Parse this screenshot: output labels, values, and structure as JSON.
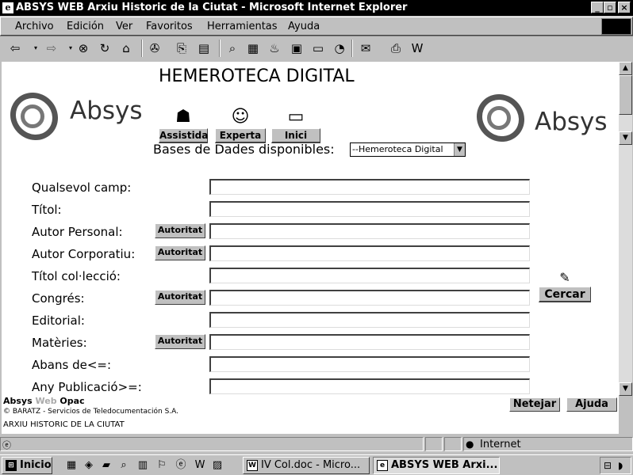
{
  "window": {
    "title": "ABSYS WEB Arxiu Historic de la Ciutat - Microsoft Internet Explorer"
  },
  "menu": [
    "Archivo",
    "Edición",
    "Ver",
    "Favoritos",
    "Herramientas",
    "Ayuda"
  ],
  "page": {
    "header": "HEMEROTECA DIGITAL",
    "logo_text": "Absys",
    "modes": [
      "Assistida",
      "Experta",
      "Inici"
    ],
    "databases_label": "Bases de Dades disponibles:",
    "database_selected": "--Hemeroteca Digital",
    "fields": [
      {
        "label": "Qualsevol camp:",
        "value": ""
      },
      {
        "label": "Títol:",
        "value": ""
      },
      {
        "label": "Autor Personal:",
        "value": ""
      },
      {
        "label": "Autor Corporatiu:",
        "value": ""
      },
      {
        "label": "Títol col·lecció:",
        "value": ""
      },
      {
        "label": "Congrés:",
        "value": ""
      },
      {
        "label": "Editorial:",
        "value": ""
      },
      {
        "label": "Matèries:",
        "value": ""
      },
      {
        "label": "Abans de<=:",
        "value": ""
      },
      {
        "label": "Any Publicació>=:",
        "value": ""
      }
    ],
    "authority_label": "Autoritat",
    "search_label": "Cercar",
    "clear_label": "Netejar",
    "help_label": "Ajuda",
    "footer_brand_1": "Absys",
    "footer_brand_2": "Web",
    "footer_brand_3": "Opac",
    "footer_company": "BARATZ - Servicios de Teledocumentación S.A.",
    "footer_org": "ARXIU HISTORIC DE LA CIUTAT"
  },
  "status": {
    "zone": "Internet"
  },
  "taskbar": {
    "start": "Inicio",
    "tasks": [
      "IV Col.doc - Micro...",
      "ABSYS WEB Arxi..."
    ]
  }
}
